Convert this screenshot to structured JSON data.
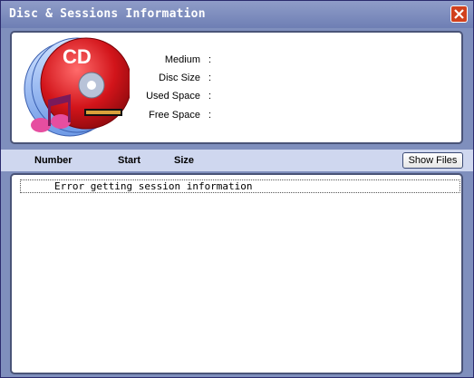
{
  "window": {
    "title": "Disc & Sessions Information"
  },
  "disc_info": {
    "logo_text": "CD",
    "rows": [
      {
        "label": "Medium",
        "value": ""
      },
      {
        "label": "Disc Size",
        "value": ""
      },
      {
        "label": "Used Space",
        "value": ""
      },
      {
        "label": "Free Space",
        "value": ""
      }
    ]
  },
  "sessions": {
    "columns": [
      "Number",
      "Start",
      "Size"
    ],
    "show_files_label": "Show Files",
    "items": [
      "Error getting session information"
    ]
  },
  "colors": {
    "title_bar": "#7d8cbf",
    "panel_border": "#4a5478",
    "close_button": "#d0401e"
  }
}
